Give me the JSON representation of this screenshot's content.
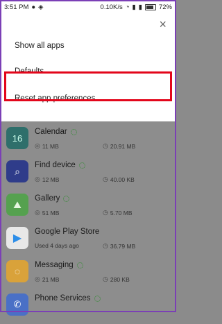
{
  "status": {
    "time": "3:51 PM",
    "network_speed": "0.10K/s",
    "battery": "72%"
  },
  "menu": {
    "close_label": "×",
    "items": [
      {
        "label": "Show all apps"
      },
      {
        "label": "Defaults"
      },
      {
        "label": "Reset app preferences"
      }
    ]
  },
  "apps": [
    {
      "name": "Calendar",
      "size": "11 MB",
      "data": "20.91 MB",
      "icon_text": "16",
      "icon_color": "#2f6f6b"
    },
    {
      "name": "Find device",
      "size": "12 MB",
      "data": "40.00 KB",
      "icon_text": "",
      "icon_color": "#2f3c8a"
    },
    {
      "name": "Gallery",
      "size": "51 MB",
      "data": "5.70 MB",
      "icon_text": "",
      "icon_color": "#55a14f"
    },
    {
      "name": "Google Play Store",
      "size": "Used 4 days ago",
      "data": "36.79 MB",
      "icon_text": "",
      "icon_color": "#e8e8e8"
    },
    {
      "name": "Messaging",
      "size": "21 MB",
      "data": "280 KB",
      "icon_text": "",
      "icon_color": "#d9a23a"
    },
    {
      "name": "Phone Services",
      "size": "",
      "data": "",
      "icon_text": "",
      "icon_color": "#4a70c6"
    }
  ]
}
